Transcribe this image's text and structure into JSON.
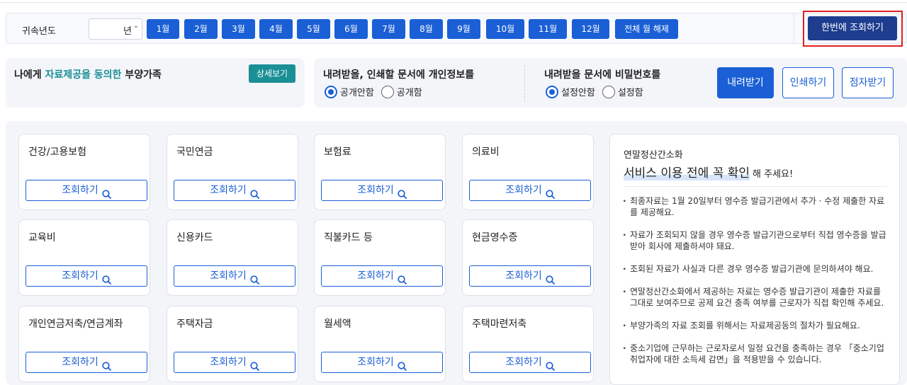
{
  "filter": {
    "label": "귀속년도",
    "year_select": "년",
    "months": [
      "1월",
      "2월",
      "3월",
      "4월",
      "5월",
      "6월",
      "7월",
      "8월",
      "9월",
      "10월",
      "11월",
      "12월"
    ],
    "clear_all_label": "전체 월 해제",
    "lookup_all_label": "한번에 조회하기"
  },
  "dependents": {
    "prefix": "나에게 ",
    "highlight": "자료제공을 동의한",
    "suffix": " 부양가족",
    "detail_label": "상세보기"
  },
  "download": {
    "personal_info_label": "내려받을, 인쇄할 문서에 개인정보를",
    "personal_options": [
      "공개안함",
      "공개함"
    ],
    "password_label": "내려받을 문서에 비밀번호를",
    "password_options": [
      "설정안함",
      "설정함"
    ],
    "download_label": "내려받기",
    "print_label": "인쇄하기",
    "braille_label": "점자받기"
  },
  "cards": [
    {
      "title": "건강/고용보험"
    },
    {
      "title": "국민연금"
    },
    {
      "title": "보험료"
    },
    {
      "title": "의료비"
    },
    {
      "title": "교육비"
    },
    {
      "title": "신용카드"
    },
    {
      "title": "직불카드 등"
    },
    {
      "title": "현금영수증"
    },
    {
      "title": "개인연금저축/연금계좌"
    },
    {
      "title": "주택자금"
    },
    {
      "title": "월세액"
    },
    {
      "title": "주택마련저축"
    }
  ],
  "card_button_label": "조회하기",
  "notice": {
    "subtitle": "연말정산간소화",
    "title_strong": "서비스 이용 전에 꼭 확인",
    "title_rest": "해 주세요!",
    "items": [
      "최종자료는 1월 20일부터 영수증 발급기관에서 추가 · 수정 제출한 자료를 제공해요.",
      "자료가 조회되지 않을 경우 영수증 발급기관으로부터 직접 영수증을 발급받아 회사에 제출하셔야 돼요.",
      "조회된 자료가 사실과 다른 경우 영수증 발급기관에 문의하셔야 해요.",
      "연말정산간소화에서 제공하는 자료는 영수증 발급기관이 제출한 자료를 그대로 보여주므로 공제 요건 충족 여부를 근로자가 직접 확인해 주세요.",
      "부양가족의 자료 조회를 위해서는 자료제공동의 절차가 필요해요.",
      "중소기업에 근무하는 근로자로서 일정 요건을 충족하는 경우 「중소기업 취업자에 대한 소득세 감면」을 적용받을 수 있습니다."
    ]
  }
}
